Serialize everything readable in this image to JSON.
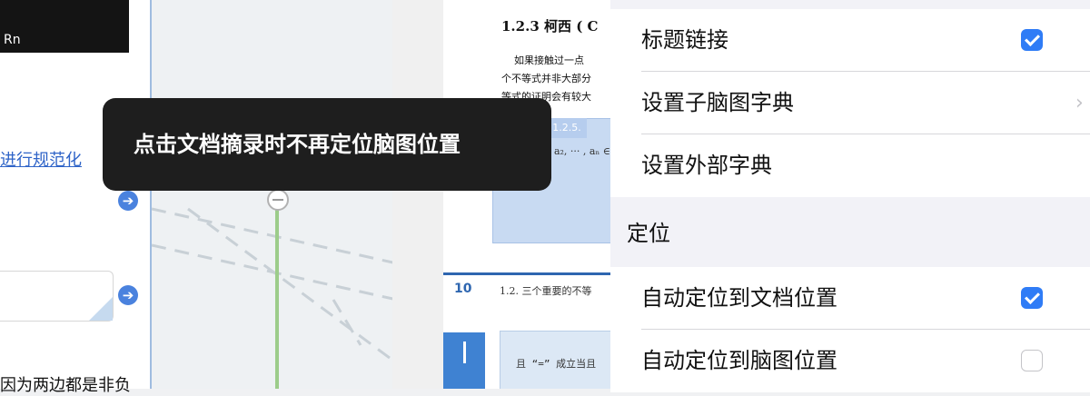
{
  "left_pane": {
    "video_caption": "Rn",
    "link_text": "进行规范化",
    "bottom_text": "因为两边都是非负"
  },
  "pdf_page": {
    "heading": "1.2.3   柯西 ( C",
    "lines": [
      "如果接触过一点",
      "个不等式并非大部分",
      "等式的证明会有较大"
    ],
    "box_tab": "1.2.5.",
    "formula": "a₁, a₂, ··· , aₙ ∈",
    "page_number": "10",
    "section_title": "1.2.  三个重要的不等",
    "formula2": "且 “=” 成立当且"
  },
  "settings": {
    "rows_top": [
      {
        "label": "标题链接",
        "checked": true
      },
      {
        "label": "设置子脑图字典",
        "chevron": "›"
      },
      {
        "label": "设置外部字典"
      }
    ],
    "section_header": "定位",
    "rows_bottom": [
      {
        "label": "自动定位到文档位置",
        "checked": true
      },
      {
        "label": "自动定位到脑图位置",
        "checked": false
      }
    ]
  },
  "toast": {
    "message": "点击文档摘录时不再定位脑图位置"
  },
  "colors": {
    "accent": "#2f7cf6",
    "toast_bg": "#1e1e1e",
    "link": "#2f64c8",
    "mindmap_branch": "#9ccc8a"
  }
}
